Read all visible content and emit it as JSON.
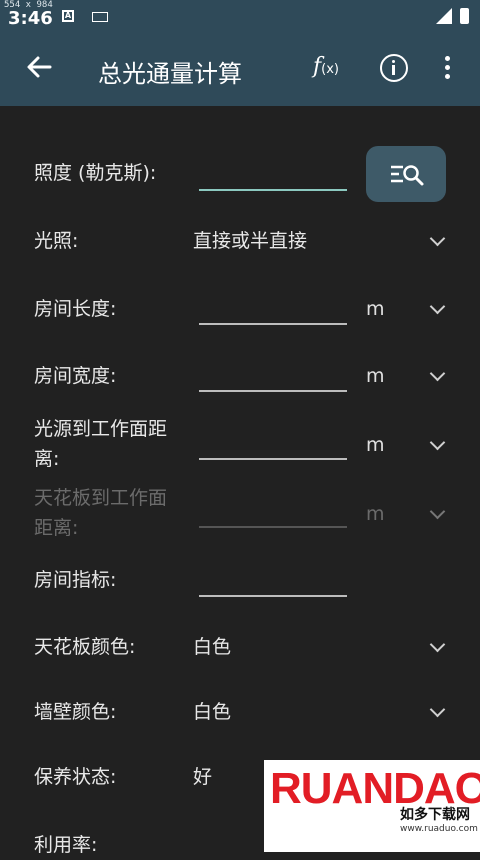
{
  "status_bar": {
    "dimension_tag": "554 x 984",
    "time": "3:46",
    "notification_icon": "A"
  },
  "app_bar": {
    "title": "总光通量计算",
    "back_icon": "arrow-back-icon",
    "formula_label": "f",
    "formula_sub": "(x)",
    "info_icon": "info-icon",
    "more_icon": "more-vert-icon"
  },
  "form": {
    "illuminance": {
      "label": "照度 (勒克斯):",
      "value": ""
    },
    "lighting": {
      "label": "光照:",
      "value": "直接或半直接"
    },
    "room_length": {
      "label": "房间长度:",
      "value": "",
      "unit": "m"
    },
    "room_width": {
      "label": "房间宽度:",
      "value": "",
      "unit": "m"
    },
    "light_to_work": {
      "label_line1": "光源到工作面距",
      "label_line2": "离:",
      "value": "",
      "unit": "m"
    },
    "ceiling_to_work": {
      "label_line1": "天花板到工作面",
      "label_line2": "距离:",
      "value": "",
      "unit": "m",
      "disabled": true
    },
    "room_index": {
      "label": "房间指标:",
      "value": ""
    },
    "ceiling_color": {
      "label": "天花板颜色:",
      "value": "白色"
    },
    "wall_color": {
      "label": "墙壁颜色:",
      "value": "白色"
    },
    "maintenance": {
      "label": "保养状态:",
      "value": "好"
    },
    "utilization": {
      "label": "利用率:"
    }
  },
  "watermark": {
    "text": "RUANDAO",
    "sub": "如多下载网",
    "url": "www.ruaduo.com"
  }
}
